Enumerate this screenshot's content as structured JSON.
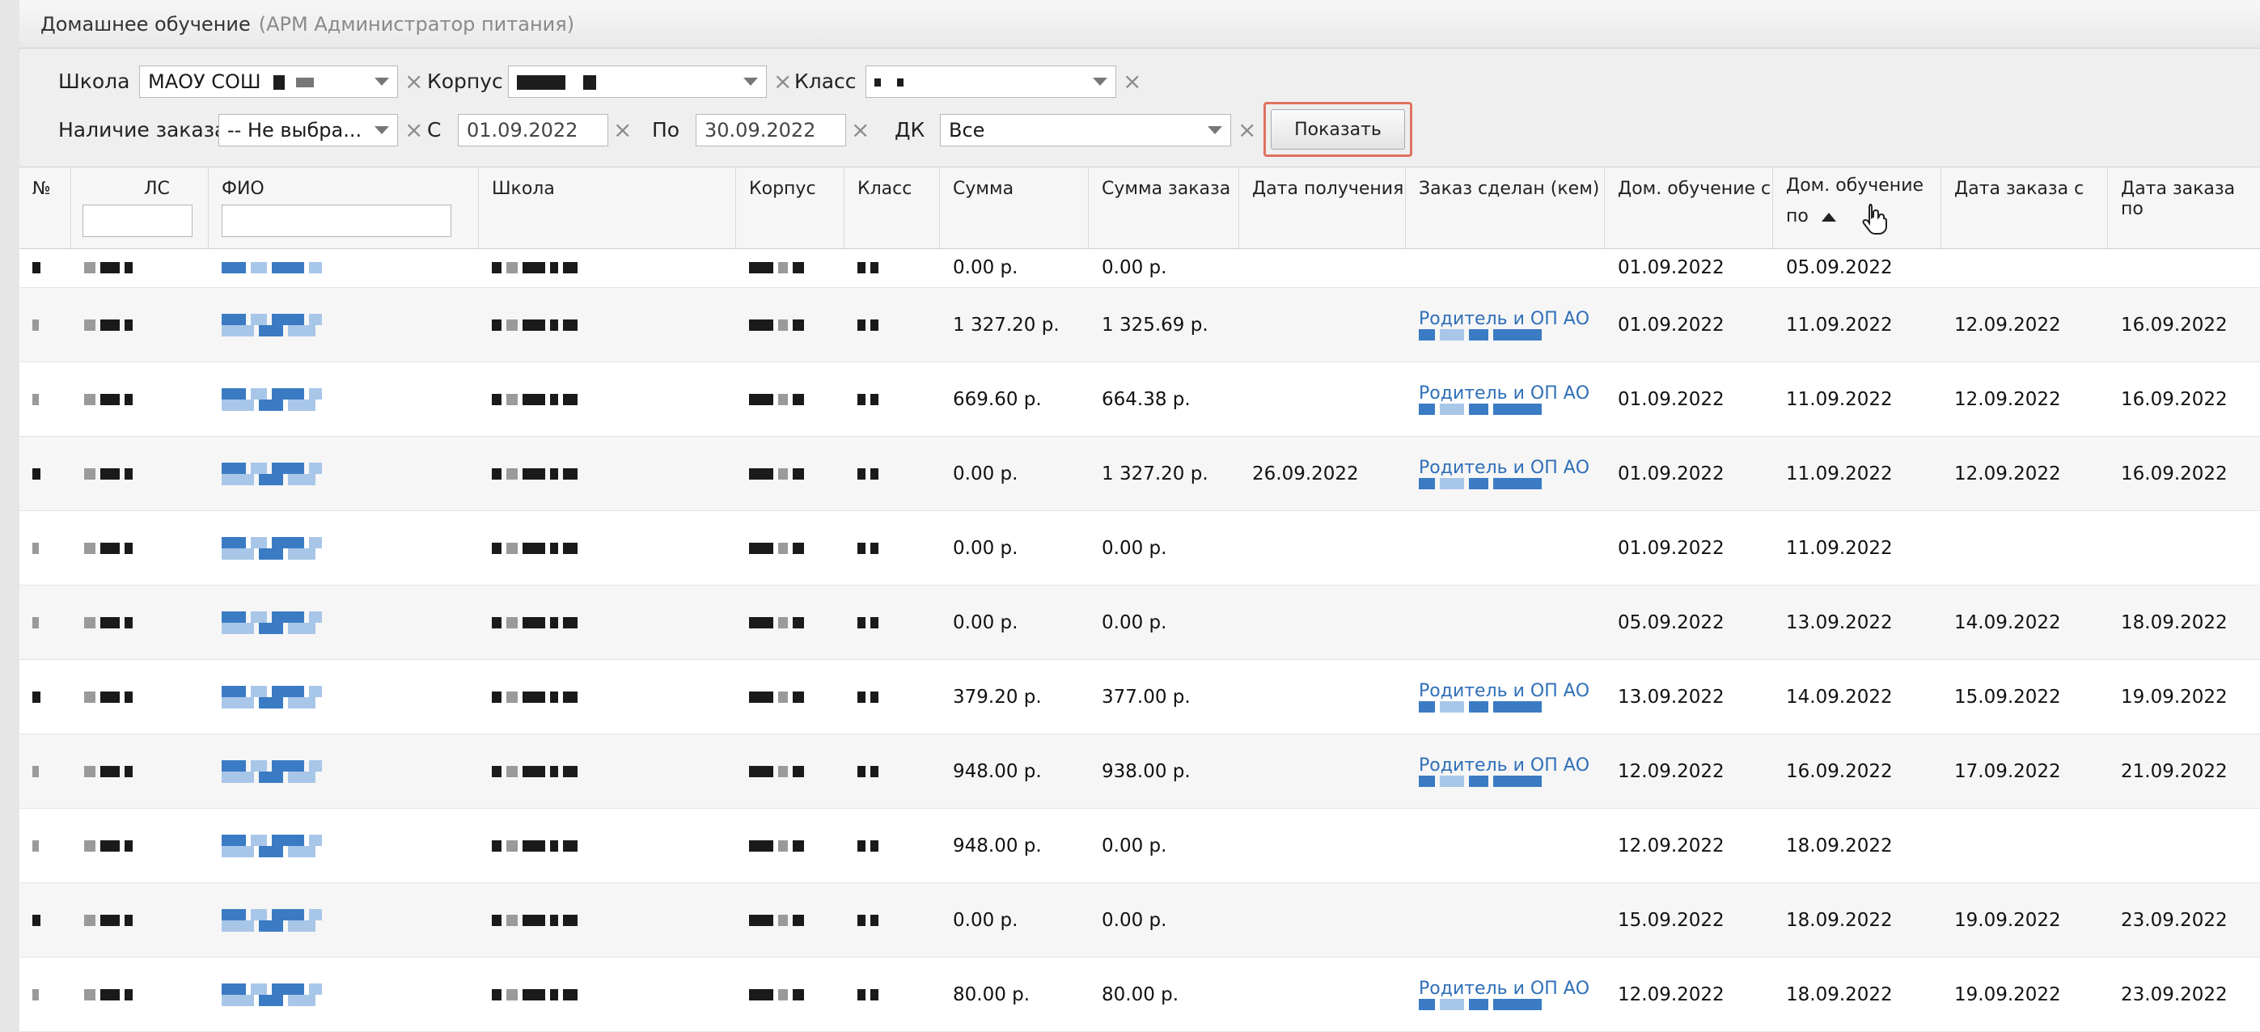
{
  "window": {
    "title": "Домашнее обучение",
    "subtitle": "(АРМ Администратор питания)"
  },
  "filters": {
    "school_label": "Школа",
    "school_value": "МАОУ СОШ",
    "korpus_label": "Корпус",
    "class_label": "Класс",
    "order_label": "Наличие заказа",
    "order_value": "-- Не выбра...",
    "from_label": "С",
    "from_value": "01.09.2022",
    "to_label": "По",
    "to_value": "30.09.2022",
    "dk_label": "ДК",
    "dk_value": "Все",
    "show_button": "Показать",
    "clear_glyph": "×"
  },
  "table": {
    "headers": {
      "num": "№",
      "ls": "ЛС",
      "fio": "ФИО",
      "school": "Школа",
      "korpus": "Корпус",
      "klass": "Класс",
      "sum": "Сумма",
      "order_sum": "Сумма заказа",
      "receive_date": "Дата получения",
      "ordered_by": "Заказ сделан (кем)",
      "home_from": "Дом. обучение с",
      "home_to_1": "Дом. обучение",
      "home_to_2": "по",
      "order_from": "Дата заказа с",
      "order_to": "Дата заказа по"
    },
    "rows": [
      {
        "sum": "0.00 р.",
        "order_sum": "0.00 р.",
        "receive": "",
        "by": "",
        "home_from": "01.09.2022",
        "home_to": "05.09.2022",
        "order_from": "",
        "order_to": ""
      },
      {
        "sum": "1 327.20 р.",
        "order_sum": "1 325.69 р.",
        "receive": "",
        "by": "Родитель и ОП АО",
        "home_from": "01.09.2022",
        "home_to": "11.09.2022",
        "order_from": "12.09.2022",
        "order_to": "16.09.2022"
      },
      {
        "sum": "669.60 р.",
        "order_sum": "664.38 р.",
        "receive": "",
        "by": "Родитель и ОП АО",
        "home_from": "01.09.2022",
        "home_to": "11.09.2022",
        "order_from": "12.09.2022",
        "order_to": "16.09.2022"
      },
      {
        "sum": "0.00 р.",
        "order_sum": "1 327.20 р.",
        "receive": "26.09.2022",
        "by": "Родитель и ОП АО",
        "home_from": "01.09.2022",
        "home_to": "11.09.2022",
        "order_from": "12.09.2022",
        "order_to": "16.09.2022"
      },
      {
        "sum": "0.00 р.",
        "order_sum": "0.00 р.",
        "receive": "",
        "by": "",
        "home_from": "01.09.2022",
        "home_to": "11.09.2022",
        "order_from": "",
        "order_to": ""
      },
      {
        "sum": "0.00 р.",
        "order_sum": "0.00 р.",
        "receive": "",
        "by": "",
        "home_from": "05.09.2022",
        "home_to": "13.09.2022",
        "order_from": "14.09.2022",
        "order_to": "18.09.2022"
      },
      {
        "sum": "379.20 р.",
        "order_sum": "377.00 р.",
        "receive": "",
        "by": "Родитель и ОП АО",
        "home_from": "13.09.2022",
        "home_to": "14.09.2022",
        "order_from": "15.09.2022",
        "order_to": "19.09.2022"
      },
      {
        "sum": "948.00 р.",
        "order_sum": "938.00 р.",
        "receive": "",
        "by": "Родитель и ОП АО",
        "home_from": "12.09.2022",
        "home_to": "16.09.2022",
        "order_from": "17.09.2022",
        "order_to": "21.09.2022"
      },
      {
        "sum": "948.00 р.",
        "order_sum": "0.00 р.",
        "receive": "",
        "by": "",
        "home_from": "12.09.2022",
        "home_to": "18.09.2022",
        "order_from": "",
        "order_to": ""
      },
      {
        "sum": "0.00 р.",
        "order_sum": "0.00 р.",
        "receive": "",
        "by": "",
        "home_from": "15.09.2022",
        "home_to": "18.09.2022",
        "order_from": "19.09.2022",
        "order_to": "23.09.2022"
      },
      {
        "sum": "80.00 р.",
        "order_sum": "80.00 р.",
        "receive": "",
        "by": "Родитель и ОП АО",
        "home_from": "12.09.2022",
        "home_to": "18.09.2022",
        "order_from": "19.09.2022",
        "order_to": "23.09.2022"
      }
    ]
  }
}
